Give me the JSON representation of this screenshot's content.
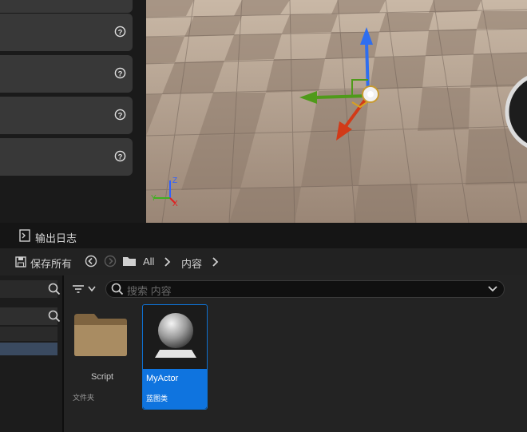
{
  "details_panel": {
    "rows": [
      {
        "help_icon": "question-circle-icon"
      },
      {
        "help_icon": "question-circle-icon"
      },
      {
        "help_icon": "question-circle-icon"
      },
      {
        "help_icon": "question-circle-icon"
      }
    ]
  },
  "viewport": {
    "gizmo": "translate-gizmo",
    "axis_labels": {
      "z": "Z",
      "y": "Y",
      "x": "X"
    }
  },
  "tabs": [
    {
      "label": "输出日志",
      "icon": "terminal-icon"
    }
  ],
  "toolbar": {
    "save_all_label": "保存所有",
    "breadcrumb": [
      "All",
      "内容"
    ]
  },
  "search": {
    "placeholder": "搜索 内容"
  },
  "assets": [
    {
      "name": "Script",
      "type": "文件夹",
      "icon": "folder-icon",
      "selected": false
    },
    {
      "name": "MyActor",
      "type": "蓝图类",
      "icon": "blueprint-sphere-icon",
      "selected": true
    }
  ],
  "colors": {
    "accent": "#0f74df",
    "panel": "#383838",
    "background": "#151515"
  }
}
